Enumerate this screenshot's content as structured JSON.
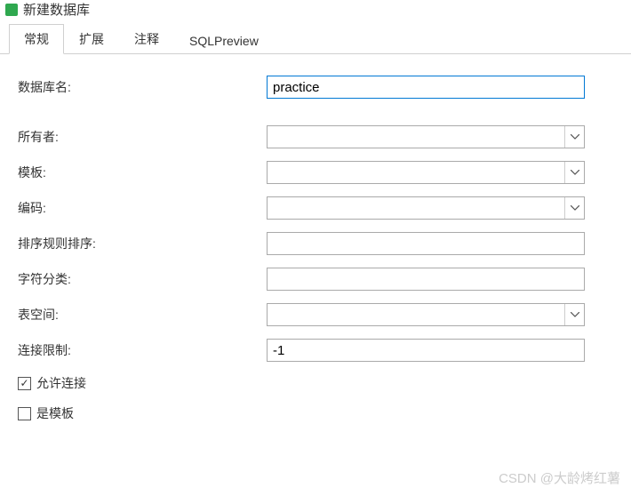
{
  "window": {
    "title": "新建数据库"
  },
  "tabs": {
    "general": "常规",
    "extension": "扩展",
    "comment": "注释",
    "sqlpreview": "SQLPreview"
  },
  "form": {
    "dbname_label": "数据库名:",
    "dbname_value": "practice",
    "owner_label": "所有者:",
    "owner_value": "",
    "template_label": "模板:",
    "template_value": "",
    "encoding_label": "编码:",
    "encoding_value": "",
    "collation_label": "排序规则排序:",
    "collation_value": "",
    "ctype_label": "字符分类:",
    "ctype_value": "",
    "tablespace_label": "表空间:",
    "tablespace_value": "",
    "connlimit_label": "连接限制:",
    "connlimit_value": "-1",
    "allowconn_label": "允许连接",
    "istemplate_label": "是模板"
  },
  "watermark": "CSDN @大龄烤红薯"
}
